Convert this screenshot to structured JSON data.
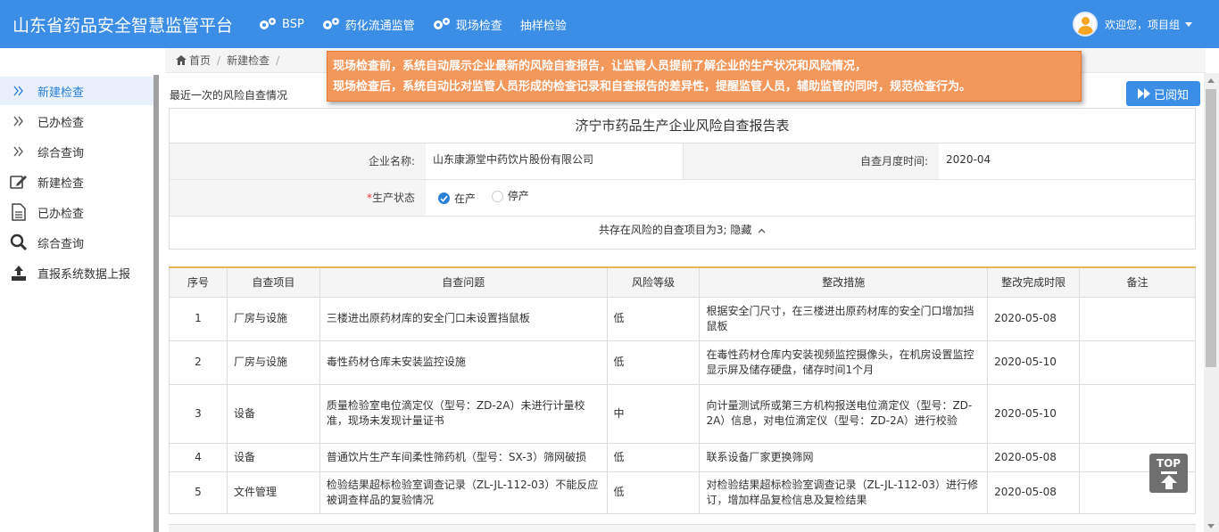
{
  "header": {
    "title": "山东省药品安全智慧监管平台",
    "nav": [
      {
        "label": "BSP"
      },
      {
        "label": "药化流通监管"
      },
      {
        "label": "现场检查"
      },
      {
        "label": "抽样检验"
      }
    ],
    "user_label": "欢迎您，项目组"
  },
  "sidebar": {
    "items": [
      {
        "label": "新建检查",
        "icon": "double-chevron-right-icon"
      },
      {
        "label": "已办检查",
        "icon": "double-chevron-right-icon"
      },
      {
        "label": "综合查询",
        "icon": "double-chevron-right-icon"
      },
      {
        "label": "新建检查",
        "icon": "edit-icon"
      },
      {
        "label": "已办检查",
        "icon": "document-icon"
      },
      {
        "label": "综合查询",
        "icon": "search-icon"
      },
      {
        "label": "直报系统数据上报",
        "icon": "upload-icon"
      }
    ]
  },
  "breadcrumb": {
    "home": "首页",
    "current": "新建检查",
    "sep": "/"
  },
  "banner": {
    "line1": "现场检查前，系统自动展示企业最新的风险自查报告，让监管人员提前了解企业的生产状况和风险情况，",
    "line2": "现场检查后，系统自动比对监管人员形成的检查记录和自查报告的差异性，提醒监管人员，辅助监管的同时，规范检查行为。"
  },
  "main": {
    "subtitle": "最近一次的风险自查情况",
    "read_button": "已阅知",
    "report": {
      "title": "济宁市药品生产企业风险自查报告表",
      "company_label": "企业名称:",
      "company_value": "山东康源堂中药饮片股份有限公司",
      "month_label": "自查月度时间:",
      "month_value": "2020-04",
      "status_req": "*",
      "status_label": "生产状态",
      "status_on": "在产",
      "status_off": "停产",
      "risk_summary": "共存在风险的自查项目为3; 隐藏"
    },
    "table": {
      "headers": [
        "序号",
        "自查项目",
        "自查问题",
        "风险等级",
        "整改措施",
        "整改完成时限",
        "备注"
      ],
      "rows": [
        {
          "no": "1",
          "item": "厂房与设施",
          "issue": "三楼进出原药材库的安全门口未设置挡鼠板",
          "level": "低",
          "measure": "根据安全门尺寸，在三楼进出原药材库的安全门口增加挡鼠板",
          "deadline": "2020-05-08",
          "remark": ""
        },
        {
          "no": "2",
          "item": "厂房与设施",
          "issue": "毒性药材仓库未安装监控设施",
          "level": "低",
          "measure": "在毒性药材仓库内安装视频监控摄像头，在机房设置监控显示屏及储存硬盘，储存时间1个月",
          "deadline": "2020-05-10",
          "remark": ""
        },
        {
          "no": "3",
          "item": "设备",
          "issue": "质量检验室电位滴定仪（型号：ZD-2A）未进行计量校准，现场未发现计量证书",
          "level": "中",
          "measure": "向计量测试所或第三方机构报送电位滴定仪（型号：ZD-2A）信息，对电位滴定仪（型号：ZD-2A）进行校验",
          "deadline": "2020-05-10",
          "remark": ""
        },
        {
          "no": "4",
          "item": "设备",
          "issue": "普通饮片生产车间柔性筛药机（型号：SX-3）筛网破损",
          "level": "低",
          "measure": "联系设备厂家更换筛网",
          "deadline": "2020-05-08",
          "remark": ""
        },
        {
          "no": "5",
          "item": "文件管理",
          "issue": "检验结果超标检验室调查记录（ZL-JL-112-03）不能反应被调查样品的复验情况",
          "level": "低",
          "measure": "对检验结果超标检验室调查记录（ZL-JL-112-03）进行修订，增加样品复检信息及复检结果",
          "deadline": "2020-05-08",
          "remark": ""
        }
      ]
    }
  },
  "top_button": "TOP"
}
